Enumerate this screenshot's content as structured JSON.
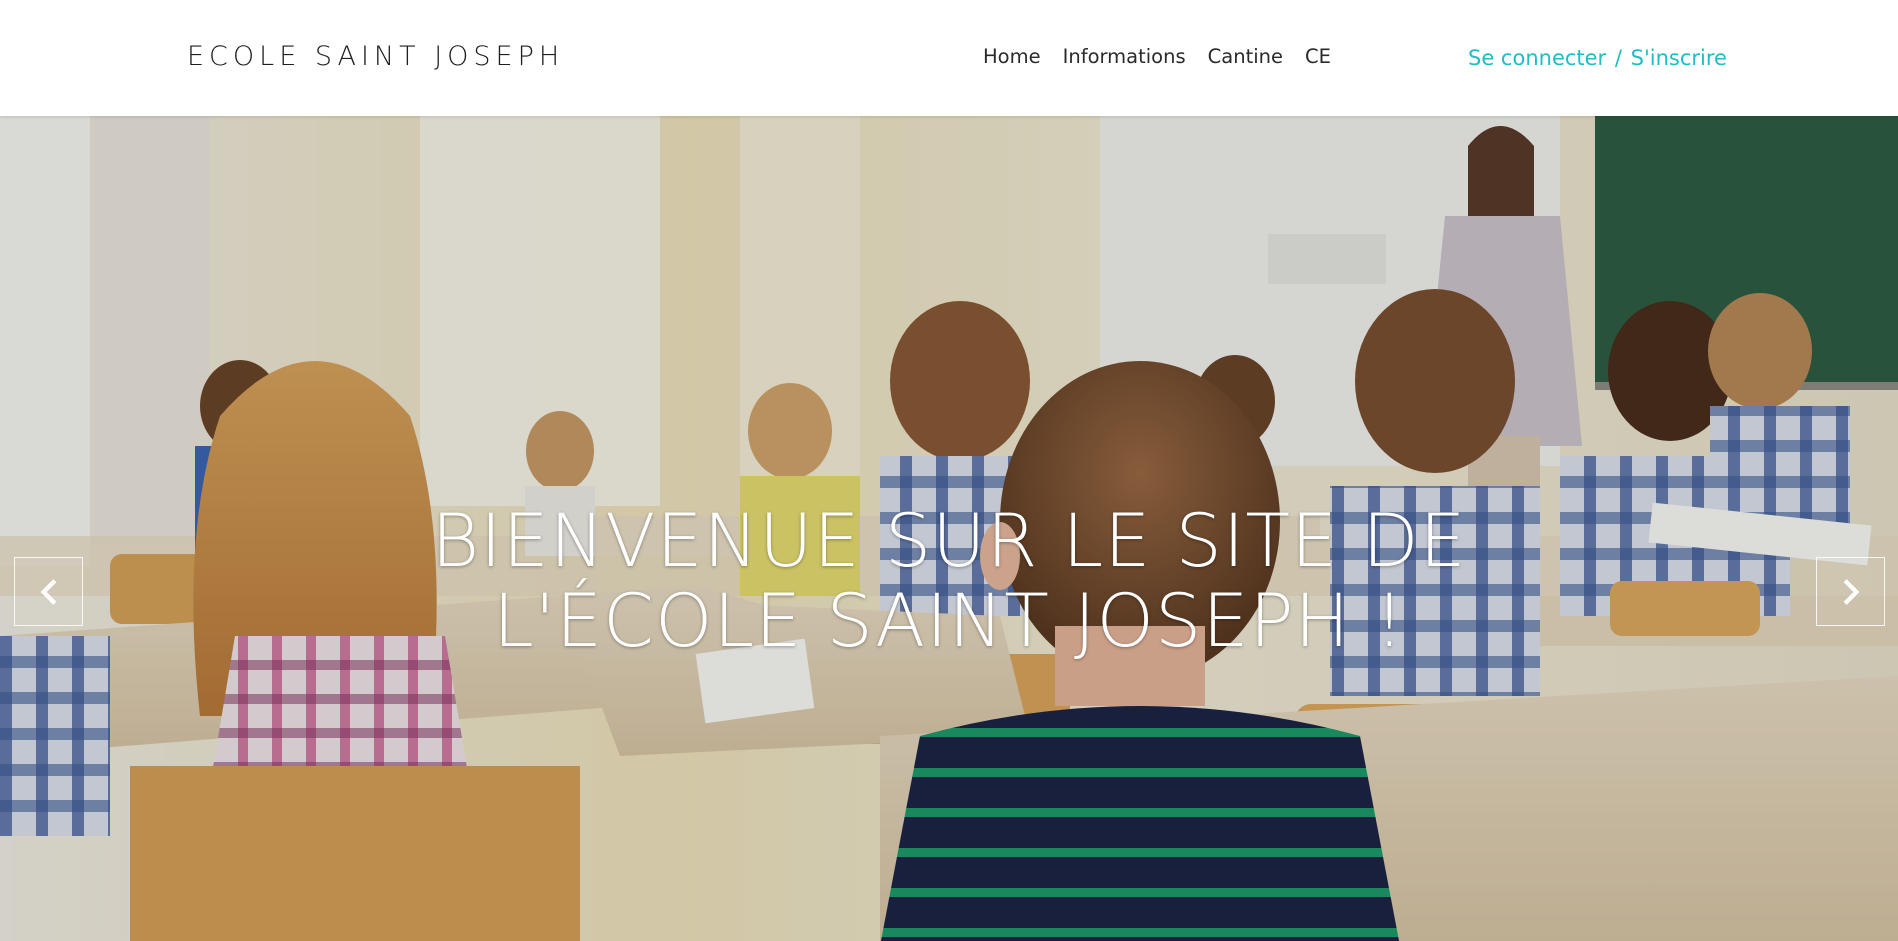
{
  "header": {
    "brand": "ECOLE SAINT JOSEPH",
    "nav": [
      {
        "label": "Home"
      },
      {
        "label": "Informations"
      },
      {
        "label": "Cantine"
      },
      {
        "label": "CE"
      }
    ],
    "auth": {
      "login": "Se connecter",
      "separator": "/",
      "register": "S'inscrire"
    }
  },
  "hero": {
    "title_line1": "BIENVENUE SUR LE SITE DE",
    "title_line2": "L'ÉCOLE SAINT JOSEPH !",
    "prev_icon": "chevron-left-icon",
    "next_icon": "chevron-right-icon"
  },
  "colors": {
    "accent": "#1cbfc6",
    "text": "#1e1e1e",
    "chalkboard": "#2f5e45"
  }
}
